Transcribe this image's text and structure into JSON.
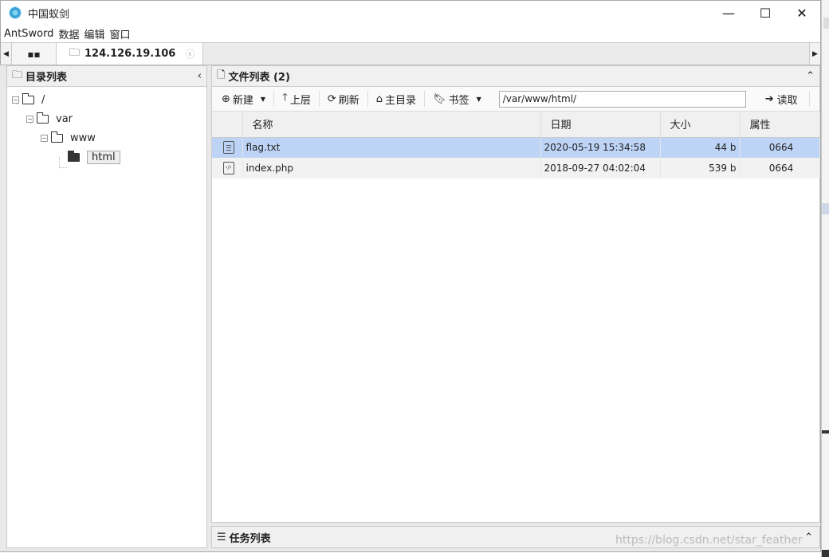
{
  "window": {
    "title": "中国蚁剑",
    "controls": {
      "minimize": "—",
      "maximize": "☐",
      "close": "✕"
    }
  },
  "menu": [
    "AntSword",
    "数据",
    "编辑",
    "窗口"
  ],
  "tabs": {
    "active_label": "124.126.19.106"
  },
  "left_panel": {
    "title": "目录列表",
    "tree": [
      {
        "label": "/"
      },
      {
        "label": "var"
      },
      {
        "label": "www"
      },
      {
        "label": "html",
        "selected": true
      }
    ]
  },
  "right_panel": {
    "title": "文件列表 (2)",
    "toolbar": {
      "new": "新建",
      "up": "上层",
      "refresh": "刷新",
      "home": "主目录",
      "bookmark": "书签",
      "path": "/var/www/html/",
      "read": "读取"
    },
    "columns": [
      "名称",
      "日期",
      "大小",
      "属性"
    ],
    "files": [
      {
        "icon": "text-file-icon",
        "name": "flag.txt",
        "date": "2020-05-19 15:34:58",
        "size": "44 b",
        "perm": "0664"
      },
      {
        "icon": "code-file-icon",
        "name": "index.php",
        "date": "2018-09-27 04:02:04",
        "size": "539 b",
        "perm": "0664"
      }
    ]
  },
  "task_panel": {
    "title": "任务列表"
  },
  "watermark": "https://blog.csdn.net/star_feather",
  "colors": {
    "selected_row": "#bdd4f6",
    "header_bg": "#f0f0f0"
  }
}
